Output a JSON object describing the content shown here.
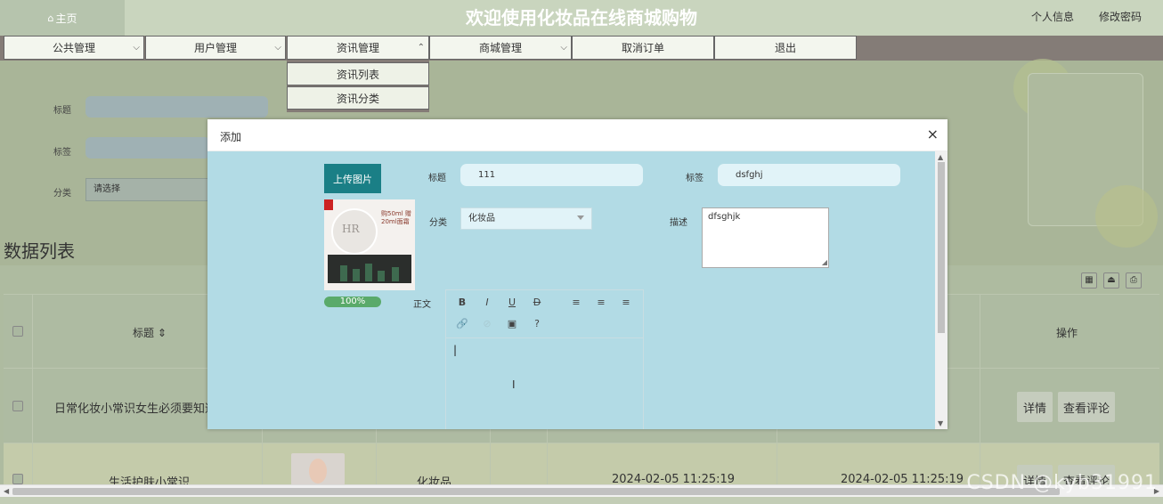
{
  "header": {
    "home_label": "主页",
    "title": "欢迎使用化妆品在线商城购物",
    "links": [
      "个人信息",
      "修改密码"
    ]
  },
  "nav": {
    "items": [
      "公共管理",
      "用户管理",
      "资讯管理",
      "商城管理",
      "取消订单",
      "退出"
    ],
    "dropdown": [
      "资讯列表",
      "资讯分类"
    ]
  },
  "filters": {
    "title_label": "标题",
    "tag_label": "标签",
    "category_label": "分类",
    "category_placeholder": "请选择"
  },
  "list": {
    "title": "数据列表",
    "columns": {
      "title": "标题 ⇕",
      "ops": "操作"
    },
    "rows": [
      {
        "title": "日常化妆小常识女生必须要知道",
        "detail": "详情",
        "comments": "查看评论"
      },
      {
        "title": "生活护肤小常识",
        "category": "化妆品",
        "created": "2024-02-05 11:25:19",
        "updated": "2024-02-05 11:25:19",
        "detail": "详情",
        "comments": "查看评论"
      }
    ]
  },
  "modal": {
    "title": "添加",
    "close": "×",
    "upload_label": "上传图片",
    "progress_text": "100%",
    "fields": {
      "title_label": "标题",
      "title_value": "111",
      "tag_label": "标签",
      "tag_value": "dsfghj",
      "category_label": "分类",
      "category_value": "化妆品",
      "desc_label": "描述",
      "desc_value": "dfsghjk",
      "body_label": "正文"
    },
    "editor_tools": [
      "B",
      "I",
      "U",
      "D",
      "≡",
      "≡",
      "≡",
      "🔗",
      "⊘",
      "▣",
      "?"
    ],
    "preview_text": "购50ml 赠20ml面霜",
    "preview_brand": "HR"
  },
  "watermark": "CSDN @kyb31991"
}
